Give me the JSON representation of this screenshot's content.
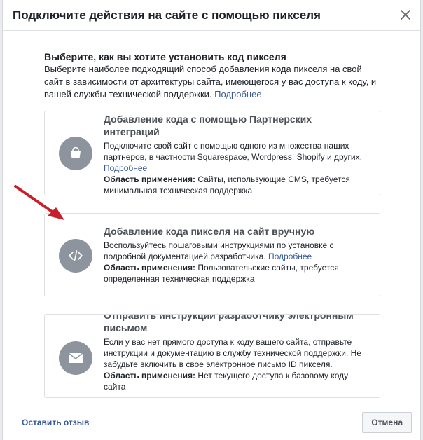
{
  "dialog": {
    "title": "Подключите действия на сайте с помощью пикселя",
    "close_icon": "close-icon"
  },
  "intro": {
    "heading": "Выберите, как вы хотите установить код пикселя",
    "text": "Выберите наиболее подходящий способ добавления кода пикселя на свой сайт в зависимости от архитектуры сайта, имеющегося у вас доступа к коду, и вашей службы технической поддержки.",
    "more_link": "Подробнее"
  },
  "options": [
    {
      "icon": "shopping-bag-icon",
      "title": "Добавление кода с помощью Партнерских интеграций",
      "description": "Подключите свой сайт с помощью одного из множества наших партнеров, в частности Squarespace, Wordpress, Shopify и других.",
      "more_link": "Подробнее",
      "scope_label": "Область применения:",
      "scope_text": "Сайты, использующие CMS, требуется минимальная техническая поддержка"
    },
    {
      "icon": "code-icon",
      "title": "Добавление кода пикселя на сайт вручную",
      "description": "Воспользуйтесь пошаговыми инструкциями по установке с подробной документацией разработчика.",
      "more_link": "Подробнее",
      "scope_label": "Область применения:",
      "scope_text": "Пользовательские сайты, требуется определенная техническая поддержка"
    },
    {
      "icon": "envelope-icon",
      "title": "Отправить инструкции разработчику электронным письмом",
      "description": "Если у вас нет прямого доступа к коду вашего сайта, отправьте инструкции и документацию в службу технической поддержки. Не забудьте включить в свое электронное письмо ID пикселя.",
      "scope_label": "Область применения:",
      "scope_text": "Нет текущего доступа к базовому коду сайта"
    }
  ],
  "footer": {
    "feedback_link": "Оставить отзыв",
    "cancel_label": "Отмена"
  },
  "colors": {
    "link": "#385898",
    "icon_circle": "#8d949e",
    "arrow": "#c7202a"
  }
}
